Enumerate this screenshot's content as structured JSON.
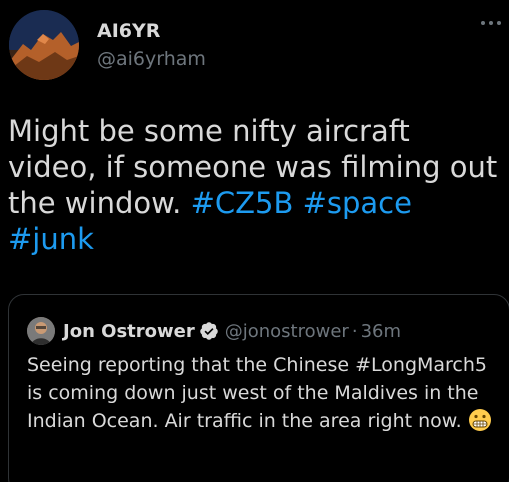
{
  "author": {
    "name": "AI6YR",
    "handle": "@ai6yrham",
    "avatar_icon": "mountain-sunset-avatar"
  },
  "more_icon": "more-horizontal-icon",
  "tweet": {
    "text_1": "Might be some nifty aircraft video, if someone was filming out the window. ",
    "hashtag_1": "#CZ5B",
    "space_1": " ",
    "hashtag_2": "#space",
    "space_2": " ",
    "hashtag_3": "#junk"
  },
  "quote": {
    "name": "Jon Ostrower",
    "handle": "@jonostrower",
    "dot": "·",
    "time": "36m",
    "verified_icon": "verified-badge-icon",
    "text": "Seeing reporting that the Chinese #LongMarch5 is coming down just west of the Maldives in the Indian Ocean. Air traffic in the area right now.",
    "emoji": "grimacing-face-emoji"
  },
  "colors": {
    "background": "#000000",
    "text": "#d9d9d9",
    "muted": "#6e767d",
    "link": "#1d9bf0",
    "border": "#2f3336",
    "verified": "#1d9bf0"
  }
}
